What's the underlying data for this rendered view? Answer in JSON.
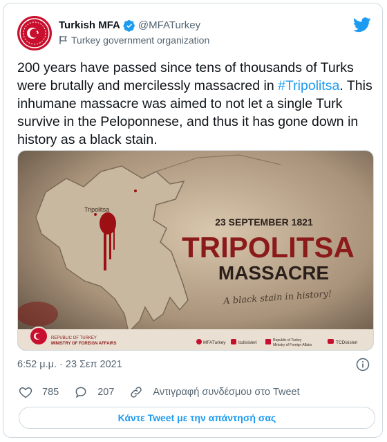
{
  "account": {
    "name": "Turkish MFA",
    "handle": "@MFATurkey",
    "label": "Turkey government organization"
  },
  "tweet": {
    "text_before": "200 years have passed since tens of thousands of Turks were brutally and mercilessly massacred in ",
    "hashtag": "#Tripolitsa",
    "text_after": ". This inhumane massacre was aimed to not let a single Turk survive in the Peloponnese, and thus it has gone down in history as a black stain."
  },
  "media": {
    "map_label": "Tripolitsa",
    "date": "23 SEPTEMBER 1821",
    "title": "TRIPOLITSA",
    "subtitle": "MASSACRE",
    "tagline": "A black stain in history!",
    "footer_org_line1": "REPUBLIC OF TURKEY",
    "footer_org_line2": "MINISTRY OF FOREIGN AFFAIRS",
    "social_twitter": "MFATurkey",
    "social_instagram": "tcdisisleri",
    "social_facebook_line1": "Republic of Turkey",
    "social_facebook_line2": "Ministry of Foreign Affairs",
    "social_youtube": "TCDisisleri"
  },
  "meta": {
    "timestamp": "6:52 μ.μ. · 23 Σεπ 2021"
  },
  "actions": {
    "likes": "785",
    "replies": "207",
    "copy_link": "Αντιγραφή συνδέσμου στο Tweet"
  },
  "reply_button": "Κάντε Tweet με την απάντησή σας",
  "colors": {
    "accent": "#1d9bf0",
    "title_red": "#8b1a1a",
    "avatar_red": "#c8102e"
  }
}
